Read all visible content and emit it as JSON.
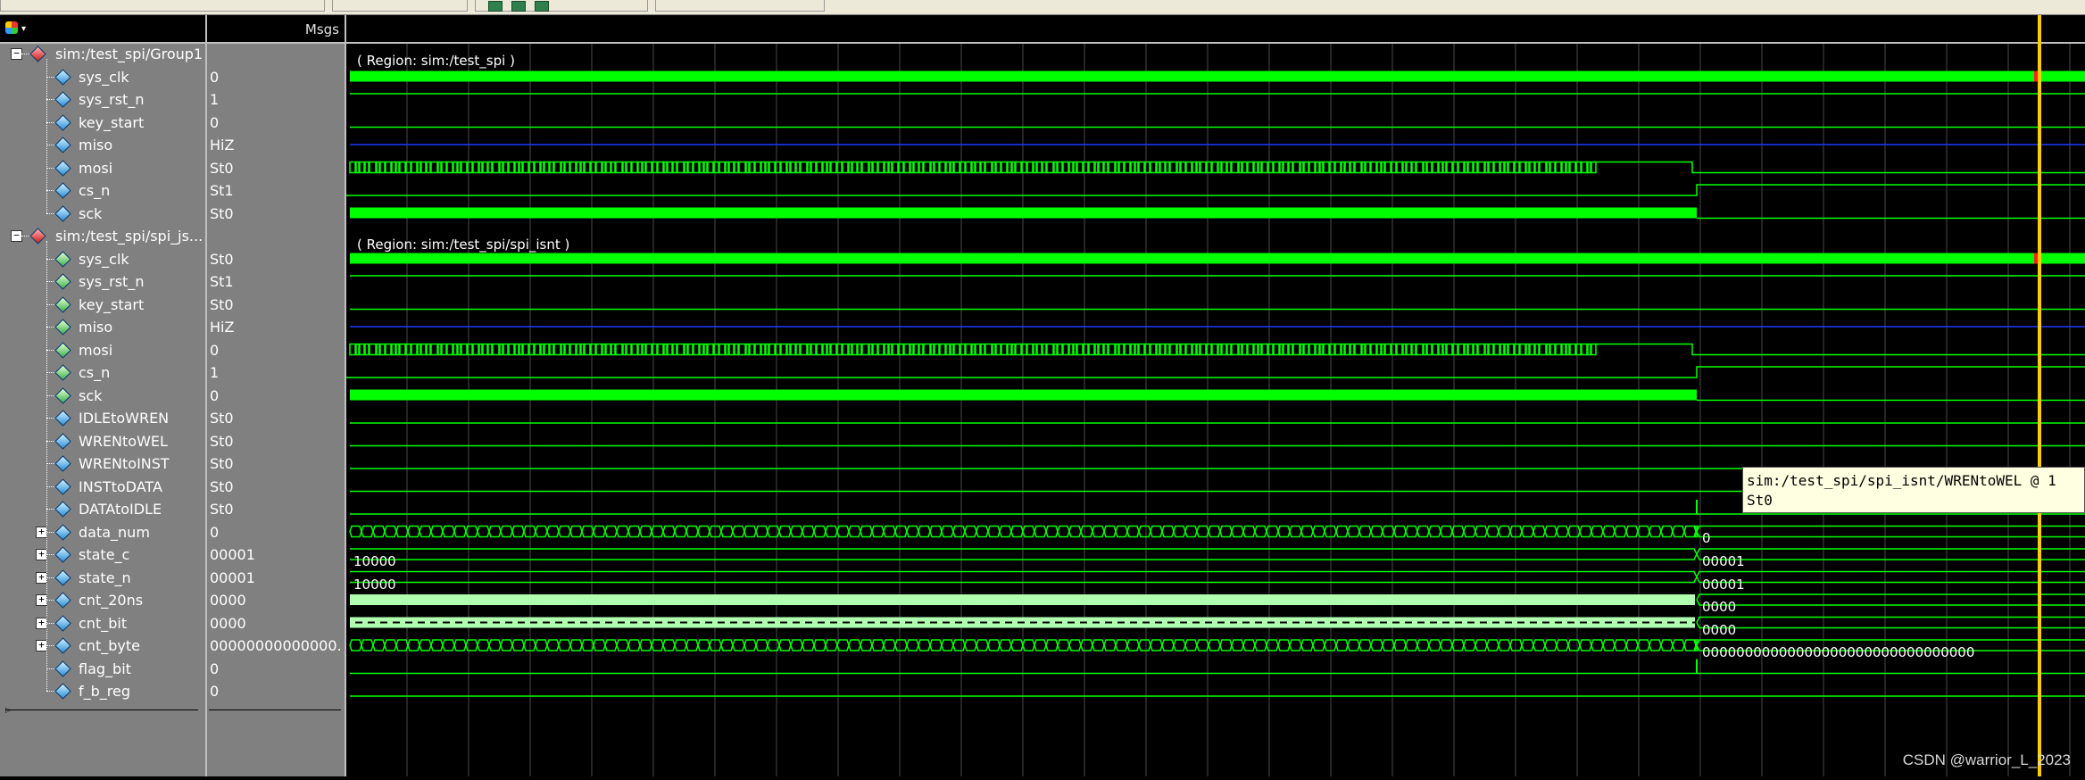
{
  "header": {
    "msgs_label": "Msgs"
  },
  "signals": [
    {
      "name": "sim:/test_spi/Group1",
      "value": "",
      "kind": "group",
      "color": "red",
      "indent": 0
    },
    {
      "name": "sys_clk",
      "value": "0",
      "kind": "signal",
      "color": "blue",
      "indent": 1
    },
    {
      "name": "sys_rst_n",
      "value": "1",
      "kind": "signal",
      "color": "blue",
      "indent": 1
    },
    {
      "name": "key_start",
      "value": "0",
      "kind": "signal",
      "color": "blue",
      "indent": 1
    },
    {
      "name": "miso",
      "value": "HiZ",
      "kind": "signal",
      "color": "blue",
      "indent": 1
    },
    {
      "name": "mosi",
      "value": "St0",
      "kind": "signal",
      "color": "blue",
      "indent": 1
    },
    {
      "name": "cs_n",
      "value": "St1",
      "kind": "signal",
      "color": "blue",
      "indent": 1
    },
    {
      "name": "sck",
      "value": "St0",
      "kind": "signal",
      "color": "blue",
      "indent": 1
    },
    {
      "name": "sim:/test_spi/spi_js...",
      "value": "",
      "kind": "group",
      "color": "red",
      "indent": 0
    },
    {
      "name": "sys_clk",
      "value": "St0",
      "kind": "signal",
      "color": "green",
      "indent": 1
    },
    {
      "name": "sys_rst_n",
      "value": "St1",
      "kind": "signal",
      "color": "green",
      "indent": 1
    },
    {
      "name": "key_start",
      "value": "St0",
      "kind": "signal",
      "color": "green",
      "indent": 1
    },
    {
      "name": "miso",
      "value": "HiZ",
      "kind": "signal",
      "color": "green",
      "indent": 1
    },
    {
      "name": "mosi",
      "value": "0",
      "kind": "signal",
      "color": "green",
      "indent": 1
    },
    {
      "name": "cs_n",
      "value": "1",
      "kind": "signal",
      "color": "green",
      "indent": 1
    },
    {
      "name": "sck",
      "value": "0",
      "kind": "signal",
      "color": "green",
      "indent": 1
    },
    {
      "name": "IDLEtoWREN",
      "value": "St0",
      "kind": "signal",
      "color": "blue",
      "indent": 1
    },
    {
      "name": "WRENtoWEL",
      "value": "St0",
      "kind": "signal",
      "color": "blue",
      "indent": 1
    },
    {
      "name": "WRENtoINST",
      "value": "St0",
      "kind": "signal",
      "color": "blue",
      "indent": 1
    },
    {
      "name": "INSTtoDATA",
      "value": "St0",
      "kind": "signal",
      "color": "blue",
      "indent": 1
    },
    {
      "name": "DATAtoIDLE",
      "value": "St0",
      "kind": "signal",
      "color": "blue",
      "indent": 1
    },
    {
      "name": "data_num",
      "value": "0",
      "kind": "bus",
      "color": "blue",
      "indent": 1
    },
    {
      "name": "state_c",
      "value": "00001",
      "kind": "bus",
      "color": "blue",
      "indent": 1
    },
    {
      "name": "state_n",
      "value": "00001",
      "kind": "bus",
      "color": "blue",
      "indent": 1
    },
    {
      "name": "cnt_20ns",
      "value": "0000",
      "kind": "bus",
      "color": "blue",
      "indent": 1
    },
    {
      "name": "cnt_bit",
      "value": "0000",
      "kind": "bus",
      "color": "blue",
      "indent": 1
    },
    {
      "name": "cnt_byte",
      "value": "00000000000000...",
      "kind": "bus",
      "color": "blue",
      "indent": 1
    },
    {
      "name": "flag_bit",
      "value": "0",
      "kind": "signal",
      "color": "blue",
      "indent": 1
    },
    {
      "name": "f_b_reg",
      "value": "0",
      "kind": "signal",
      "color": "blue",
      "indent": 1
    }
  ],
  "waves": {
    "region1": "( Region: sim:/test_spi )",
    "region2": "( Region: sim:/test_spi/spi_isnt )",
    "state_c_before": "10000",
    "state_c_after": "00001",
    "state_n_before": "10000",
    "state_n_after": "00001",
    "data_num_after": "0",
    "cnt_20ns_after": "0000",
    "cnt_bit_after": "0000",
    "cnt_byte_after": "00000000000000000000000000000000"
  },
  "tooltip": {
    "line1": "sim:/test_spi/spi_isnt/WRENtoWEL @ 1",
    "line2": "St0"
  },
  "watermark": "CSDN @warrior_L_2023",
  "colors": {
    "wave": "#00ff00",
    "bus_fill": "#b0ffb0",
    "hiz": "#1a3cff",
    "cursor": "#ffcc00",
    "grid": "#4a4a4a"
  }
}
